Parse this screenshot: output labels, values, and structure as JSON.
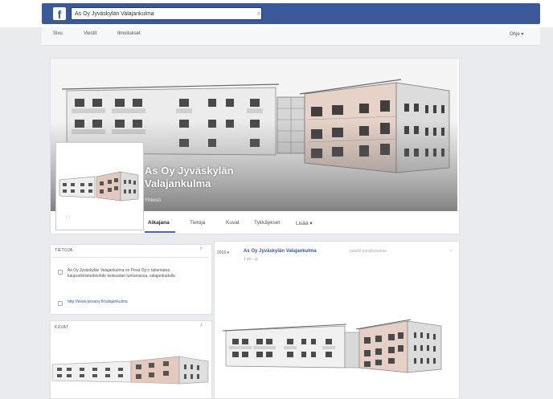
{
  "topbar": {
    "search_value": "As Oy Jyväskylän Valajankulma"
  },
  "subnav": {
    "items": [
      "Sivu",
      "Viestit",
      "Ilmoitukset"
    ],
    "help": "Ohje ▾"
  },
  "page": {
    "name": "As Oy Jyväskylän Valajankulma",
    "category": "Yhteisö"
  },
  "tabs": [
    "Aikajana",
    "Tietoja",
    "Kuvat",
    "Tykkäykset",
    "Lisää ▾"
  ],
  "about_card": {
    "title": "TIETOJA",
    "description": "As Oy Jyväskylän Valajankulma on Pesä Oy:n rakentama kaupunkirivitalokohde keskustan tuntumassa, valajankadulla",
    "url": "http://www.pesaoy.fi/valajankulma",
    "chevron": "›"
  },
  "photos_card": {
    "title": "KUVAT",
    "chevron": "›"
  },
  "post": {
    "avatar_text": "2016 ▾",
    "author": "As Oy Jyväskylän Valajankulma",
    "meta": "päivitti kansikuvansa",
    "time": "1 pv · ◎",
    "menu": "⌄"
  },
  "colors": {
    "brand": "#3b5998",
    "link": "#365899",
    "accent": "#4267b2"
  }
}
